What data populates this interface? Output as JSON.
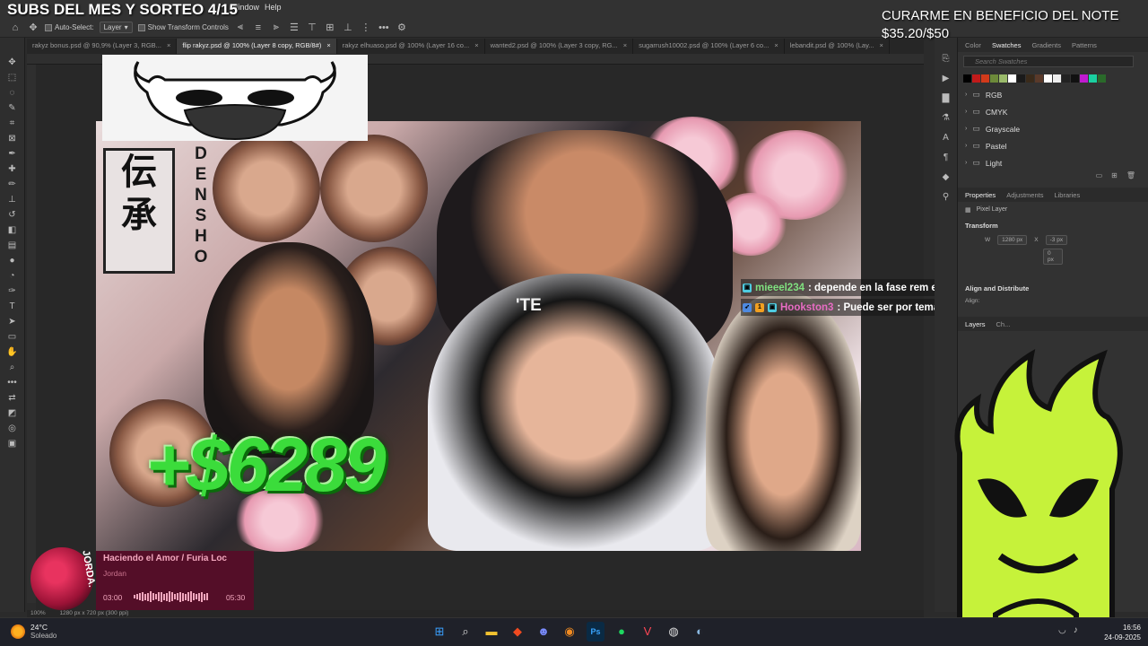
{
  "overlay": {
    "title": "SUBS DEL MES Y SORTEO 4/15",
    "goal_text": "CURARME EN BENEFICIO DEL NOTE",
    "goal_amount": "$35.20/$50"
  },
  "menu": {
    "window": "Window",
    "help": "Help"
  },
  "options_bar": {
    "auto_select_label": "Auto-Select:",
    "auto_select_value": "Layer",
    "transform_label": "Show Transform Controls",
    "more_icon": "more-dots-icon",
    "settings_icon": "gear-icon"
  },
  "tabs": [
    {
      "label": "rakyz bonus.psd @ 90,9% (Layer 3, RGB...",
      "active": false
    },
    {
      "label": "flip rakyz.psd @ 100% (Layer 8 copy, RGB/8#)",
      "active": true
    },
    {
      "label": "rakyz elhuaso.psd @ 100% (Layer 16 co...",
      "active": false
    },
    {
      "label": "wanted2.psd @ 100% (Layer 3 copy, RG...",
      "active": false
    },
    {
      "label": "sugarrush10002.psd @ 100% (Layer 6 co...",
      "active": false
    },
    {
      "label": "lebandit.psd @ 100% (Lay...",
      "active": false
    }
  ],
  "thumbnail": {
    "money": "+$6289",
    "kanji": [
      "伝",
      "承"
    ],
    "densho": [
      "D",
      "E",
      "N",
      "S",
      "H",
      "O"
    ],
    "cap_text": "'TE"
  },
  "chat": [
    {
      "user": "mieeel234",
      "message": ": depende en la fase rem en la q despiertes",
      "user_color": "#7fe07f"
    },
    {
      "user": "Hookston3",
      "message": ": Puede ser por temas de respiracion",
      "user_color": "#e86cc4"
    }
  ],
  "swatches_panel": {
    "tabs": [
      "Color",
      "Swatches",
      "Gradients",
      "Patterns"
    ],
    "active_tab": "Swatches",
    "search_placeholder": "Search Swatches",
    "colors": [
      "#000000",
      "#c11a1a",
      "#d23a1a",
      "#6d8a3a",
      "#9aba6a",
      "#ffffff",
      "#1a1a1a",
      "#3a2a1a",
      "#5a3a2a",
      "#ffffff",
      "#eeeeee",
      "#222222",
      "#111111",
      "#c01ad0",
      "#1ad0a0",
      "#2a6a2a"
    ],
    "folders": [
      "RGB",
      "CMYK",
      "Grayscale",
      "Pastel",
      "Light"
    ]
  },
  "properties_panel": {
    "tabs": [
      "Properties",
      "Adjustments",
      "Libraries"
    ],
    "active_tab": "Properties",
    "layer_type": "Pixel Layer",
    "transform_title": "Transform",
    "w_label": "W",
    "w_value": "1280 px",
    "x_label": "X",
    "x_value": "-3 px",
    "y_value": "0 px",
    "align_title": "Align and Distribute",
    "align_label": "Align:"
  },
  "layers_panel": {
    "tabs": [
      "Layers",
      "Ch..."
    ]
  },
  "music": {
    "song": "Haciendo el Amor / Furia Loc",
    "artist": "Jordan",
    "time_current": "03:00",
    "time_total": "05:30",
    "progress": 0.55,
    "art_text": "JORDA."
  },
  "status_bar": {
    "zoom": "100%",
    "doc_size": "1280 px x 720 px (300 ppi)"
  },
  "taskbar": {
    "temp": "24°C",
    "condition": "Soleado",
    "time": "16:56",
    "date": "24-09-2025",
    "apps": [
      "windows-start-icon",
      "search-icon",
      "file-explorer-icon",
      "brave-browser-icon",
      "discord-icon",
      "blender-icon",
      "photoshop-icon",
      "spotify-icon",
      "valorant-icon",
      "app-icon",
      "steam-icon"
    ],
    "ps_label": "Ps"
  },
  "colors": {
    "accent": "#3bdc3b",
    "mascot": "#c6f23a",
    "music_bg": "#5a0a28"
  }
}
